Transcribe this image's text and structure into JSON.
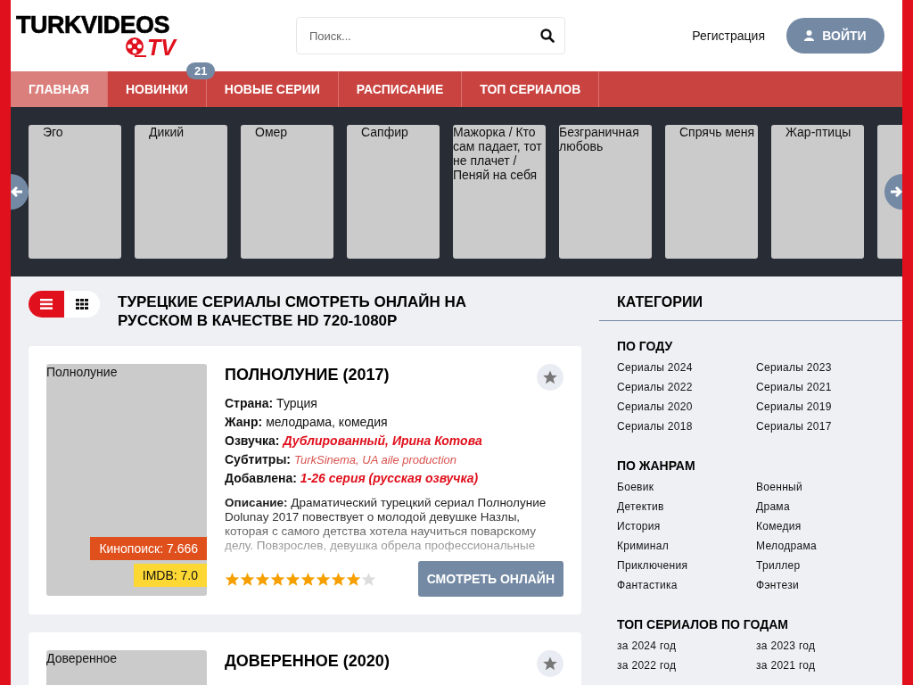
{
  "logo": {
    "main": "TURKVIDEOS",
    "sub": "TV"
  },
  "search": {
    "placeholder": "Поиск..."
  },
  "header_links": {
    "register": "Регистрация",
    "login": "ВОЙТИ"
  },
  "nav": [
    {
      "label": "ГЛАВНАЯ",
      "selected": true
    },
    {
      "label": "НОВИНКИ",
      "selected": false,
      "badge": "21"
    },
    {
      "label": "НОВЫЕ СЕРИИ",
      "selected": false
    },
    {
      "label": "РАСПИСАНИЕ",
      "selected": false
    },
    {
      "label": "ТОП СЕРИАЛОВ",
      "selected": false
    }
  ],
  "carousel": [
    {
      "title": "Эго"
    },
    {
      "title": "Дикий"
    },
    {
      "title": "Омер"
    },
    {
      "title": "Сапфир"
    },
    {
      "title": "Мажорка / Кто сам падает, тот не плачет / Пеняй на себя"
    },
    {
      "title": "Безграничная любовь"
    },
    {
      "title": "Спрячь меня"
    },
    {
      "title": "Жар-птицы"
    }
  ],
  "carousel_more": true,
  "view_toggle": [
    {
      "kind": "list",
      "selected": true
    },
    {
      "kind": "grid",
      "selected": false
    }
  ],
  "page_title": "ТУРЕЦКИЕ СЕРИАЛЫ СМОТРЕТЬ ОНЛАЙН НА РУССКОМ В КАЧЕСТВЕ HD 720-1080P",
  "cards": [
    {
      "title": "ПОЛНОЛУНИЕ (2017)",
      "image_alt": "Полнолуние",
      "fields": [
        {
          "label": "Страна:",
          "value": "Турция",
          "kind": "plain"
        },
        {
          "label": "Жанр:",
          "value": "мелодрама, комедия",
          "kind": "plain"
        },
        {
          "label": "Озвучка:",
          "value": "Дублированный, Ирина Котова",
          "kind": "accent"
        },
        {
          "label": "Субтитры:",
          "value": "TurkSinema, UA aile production",
          "kind": "subtle"
        },
        {
          "label": "Добавлена:",
          "value": "1-26 серия (русская озвучка)",
          "kind": "accent"
        }
      ],
      "description_label": "Описание:",
      "description": "Драматический турецкий сериал Полнолуние Dolunay 2017 повествует о молодой девушке Назлы, которая с самого детства хотела научиться поварскому делу. Повзрослев, девушка обрела профессиональные",
      "kinopoisk": "Кинопоиск: 7.666",
      "imdb": "IMDB: 7.0",
      "stars": 9,
      "button": "СМОТРЕТЬ ОНЛАЙН"
    },
    {
      "title": "ДОВЕРЕННОЕ (2020)",
      "image_alt": "Доверенное"
    }
  ],
  "sidebar": {
    "title": "КАТЕГОРИИ",
    "sections": [
      {
        "heading": "ПО ГОДУ",
        "links": [
          "Сериалы 2024",
          "Сериалы 2023",
          "Сериалы 2022",
          "Сериалы 2021",
          "Сериалы 2020",
          "Сериалы 2019",
          "Сериалы 2018",
          "Сериалы 2017"
        ]
      },
      {
        "heading": "ПО ЖАНРАМ",
        "links": [
          "Боевик",
          "Военный",
          "Детектив",
          "Драма",
          "История",
          "Комедия",
          "Криминал",
          "Мелодрама",
          "Приключения",
          "Триллер",
          "Фантастика",
          "Фэнтези"
        ]
      },
      {
        "heading": "ТОП СЕРИАЛОВ ПО ГОДАМ",
        "links": [
          "за 2024 год",
          "за 2023 год",
          "за 2022 год",
          "за 2021 год"
        ]
      }
    ]
  }
}
